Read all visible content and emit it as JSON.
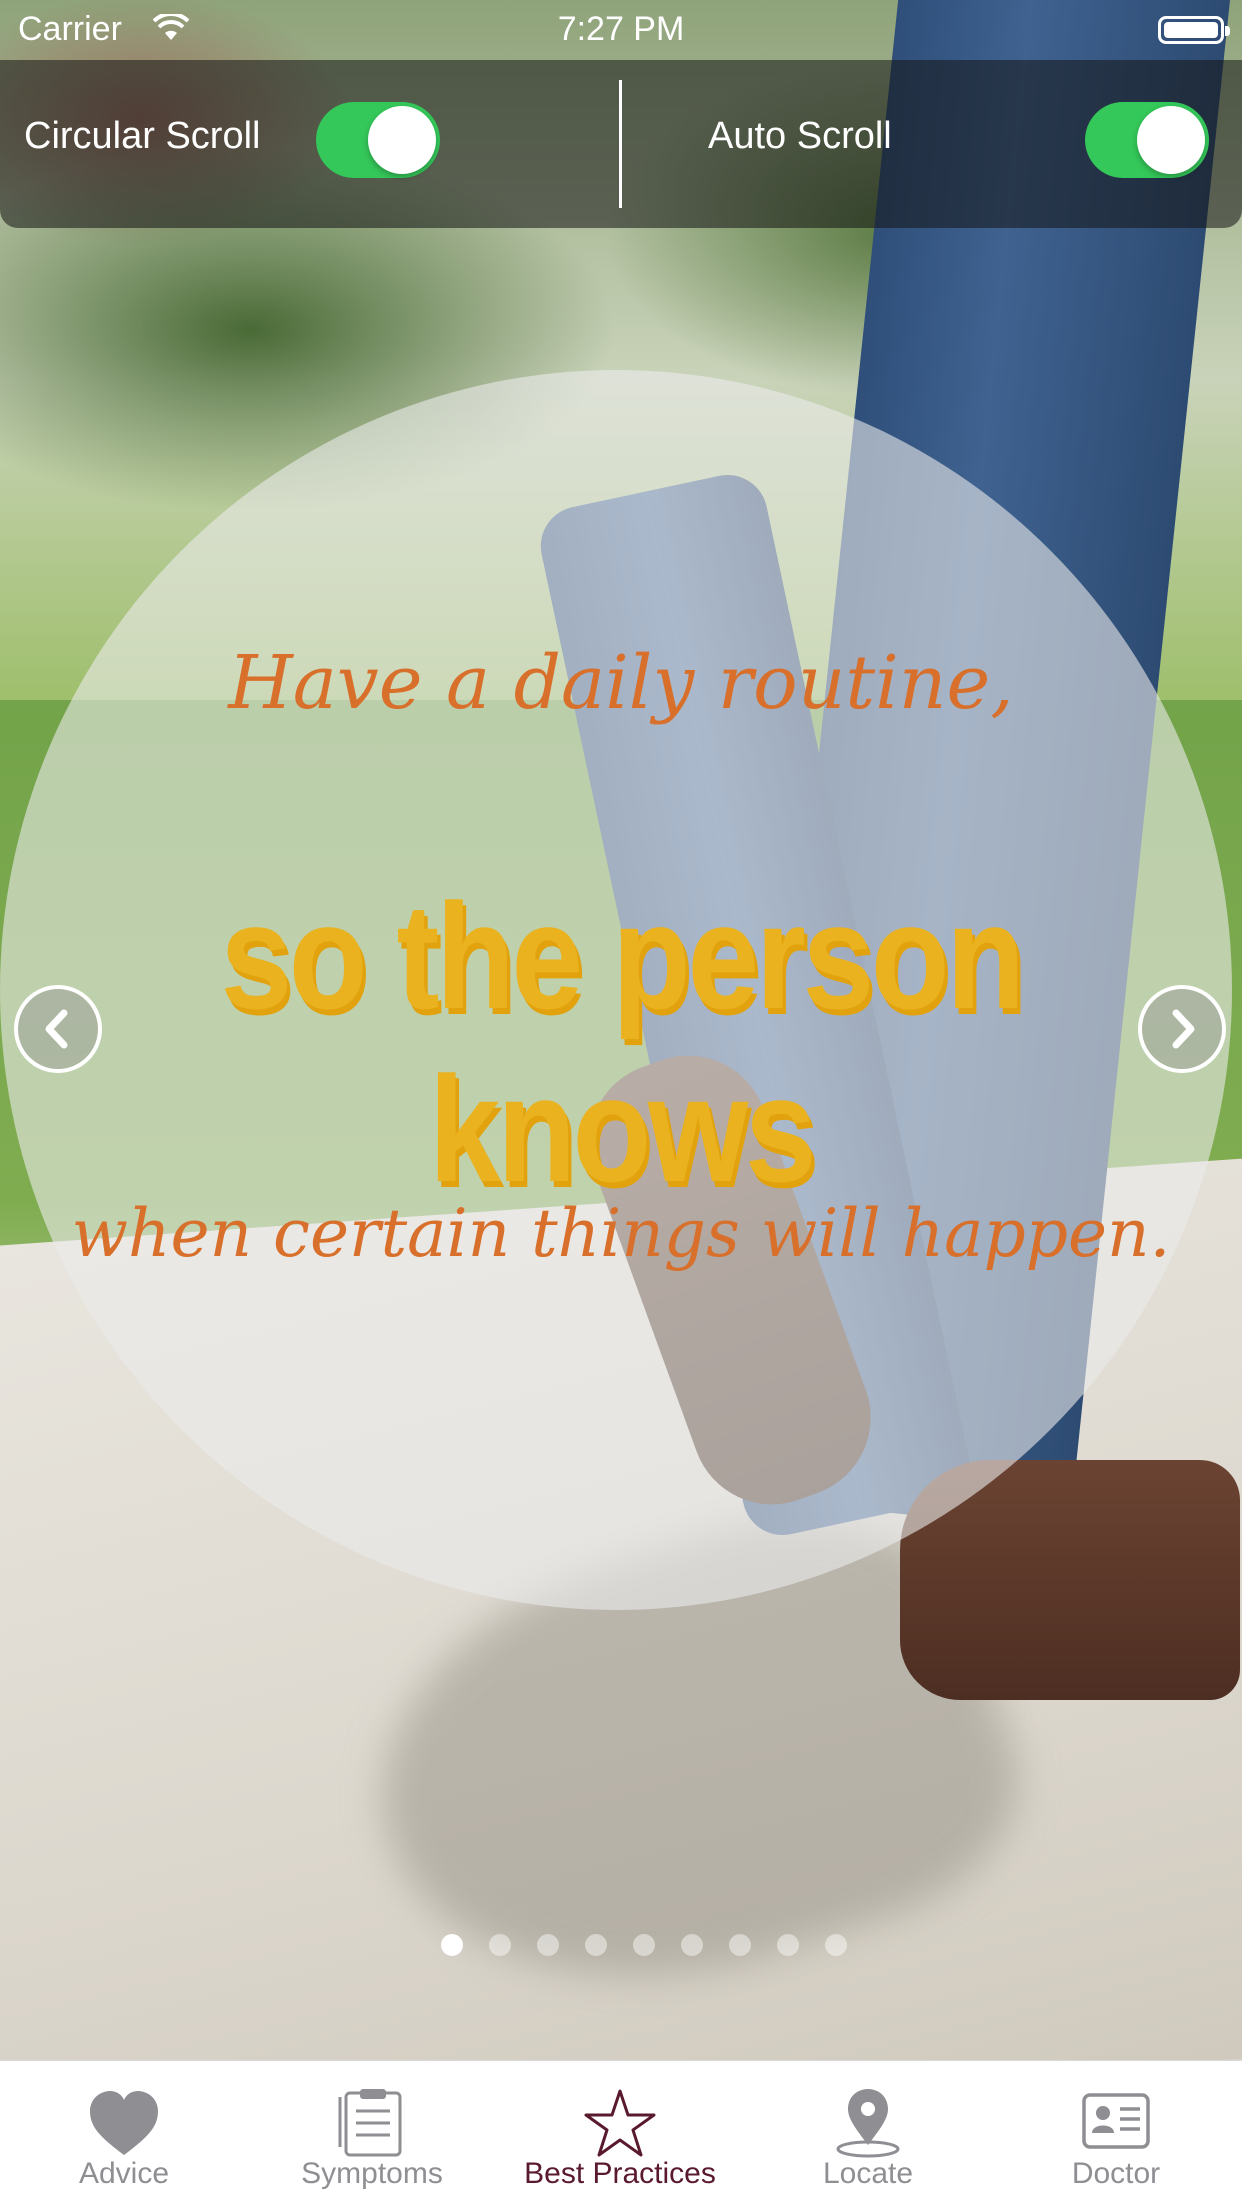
{
  "status_bar": {
    "carrier": "Carrier",
    "time": "7:27 PM"
  },
  "controls": {
    "circular_scroll_label": "Circular Scroll",
    "circular_scroll_on": true,
    "auto_scroll_label": "Auto Scroll",
    "auto_scroll_on": true,
    "toggle_color": "#34c759"
  },
  "slide": {
    "line1": "Have a daily routine,",
    "line2": "so the person knows",
    "line3": "when certain things will happen."
  },
  "pager": {
    "total": 9,
    "current": 1
  },
  "tabbar": {
    "active_color": "#5a1a2e",
    "inactive_color": "#8e8e93",
    "tabs": [
      {
        "label": "Advice",
        "icon": "heart-icon"
      },
      {
        "label": "Symptoms",
        "icon": "clipboard-icon"
      },
      {
        "label": "Best Practices",
        "icon": "star-icon",
        "active": true
      },
      {
        "label": "Locate",
        "icon": "location-pin-icon"
      },
      {
        "label": "Doctor",
        "icon": "contact-card-icon"
      }
    ]
  }
}
